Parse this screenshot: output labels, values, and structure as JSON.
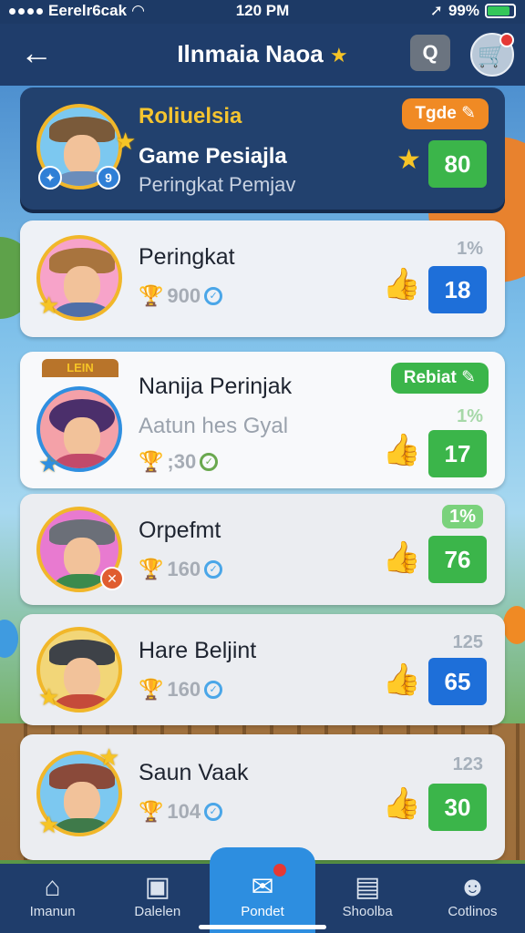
{
  "status_bar": {
    "carrier": "Eerelr6cak",
    "time": "120 PM",
    "battery": "99%",
    "location_icon": "location-arrow-icon"
  },
  "header": {
    "title": "Ilnmaia Naoa",
    "back_icon": "arrow-left-icon",
    "search_icon": "search-icon",
    "cart_icon": "cart-icon"
  },
  "featured": {
    "name": "Roliuelsia",
    "subtitle": "Game Pesiajla",
    "caption": "Peringkat Pemjav",
    "pill": "Tgde",
    "score": "80",
    "badge": "9"
  },
  "rows": [
    {
      "name": "Peringkat",
      "stat": "900",
      "rank": "1%",
      "score": "18",
      "score_color": "blue"
    },
    {
      "name": "Nanija Perinjak",
      "subtitle": "Aatun hes Gyal",
      "stat": ";30",
      "rank": "1%",
      "score": "17",
      "score_color": "green",
      "pill": "Rebiat",
      "banner": "LEIN"
    },
    {
      "name": "Orpefmt",
      "stat": "160",
      "rank": "1%",
      "score": "76",
      "score_color": "green"
    },
    {
      "name": "Hare Beljint",
      "stat": "160",
      "rank": "125",
      "score": "65",
      "score_color": "blue"
    },
    {
      "name": "Saun Vaak",
      "stat": "104",
      "rank": "123",
      "score": "30",
      "score_color": "green"
    }
  ],
  "bottom_nav": [
    {
      "label": "Imanun",
      "icon": "home-icon"
    },
    {
      "label": "Dalelen",
      "icon": "clipboard-icon"
    },
    {
      "label": "Pondet",
      "icon": "chat-icon",
      "active": true
    },
    {
      "label": "Shoolba",
      "icon": "shop-icon"
    },
    {
      "label": "Cotlinos",
      "icon": "profile-icon"
    }
  ]
}
